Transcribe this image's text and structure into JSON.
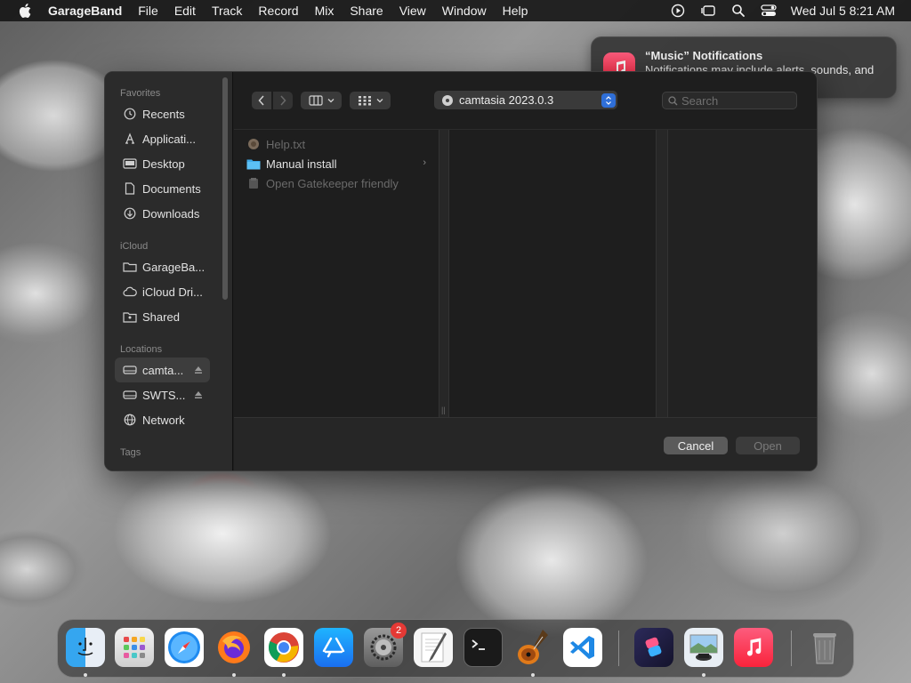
{
  "menubar": {
    "app_name": "GarageBand",
    "menus": [
      "File",
      "Edit",
      "Track",
      "Record",
      "Mix",
      "Share",
      "View",
      "Window",
      "Help"
    ],
    "clock": "Wed Jul 5  8:21 AM"
  },
  "notification": {
    "title": "“Music” Notifications",
    "body": "Notifications may include alerts, sounds, and icon badges."
  },
  "dialog": {
    "sidebar": {
      "favorites_title": "Favorites",
      "favorites": [
        "Recents",
        "Applicati...",
        "Desktop",
        "Documents",
        "Downloads"
      ],
      "icloud_title": "iCloud",
      "icloud": [
        "GarageBa...",
        "iCloud Dri...",
        "Shared"
      ],
      "locations_title": "Locations",
      "locations": [
        "camta...",
        "SWTS...",
        "Network"
      ],
      "tags_title": "Tags"
    },
    "location": "camtasia 2023.0.3",
    "search_placeholder": "Search",
    "files": [
      "Help.txt",
      "Manual install",
      "Open Gatekeeper friendly"
    ],
    "cancel_label": "Cancel",
    "open_label": "Open"
  },
  "dock": {
    "apps": [
      "Finder",
      "Launchpad",
      "Safari",
      "Firefox",
      "Chrome",
      "App Store",
      "System Settings",
      "TextEdit",
      "Terminal",
      "GarageBand",
      "Visual Studio Code",
      "Shortcuts",
      "Preview",
      "Music",
      "Trash"
    ],
    "settings_badge": "2"
  }
}
